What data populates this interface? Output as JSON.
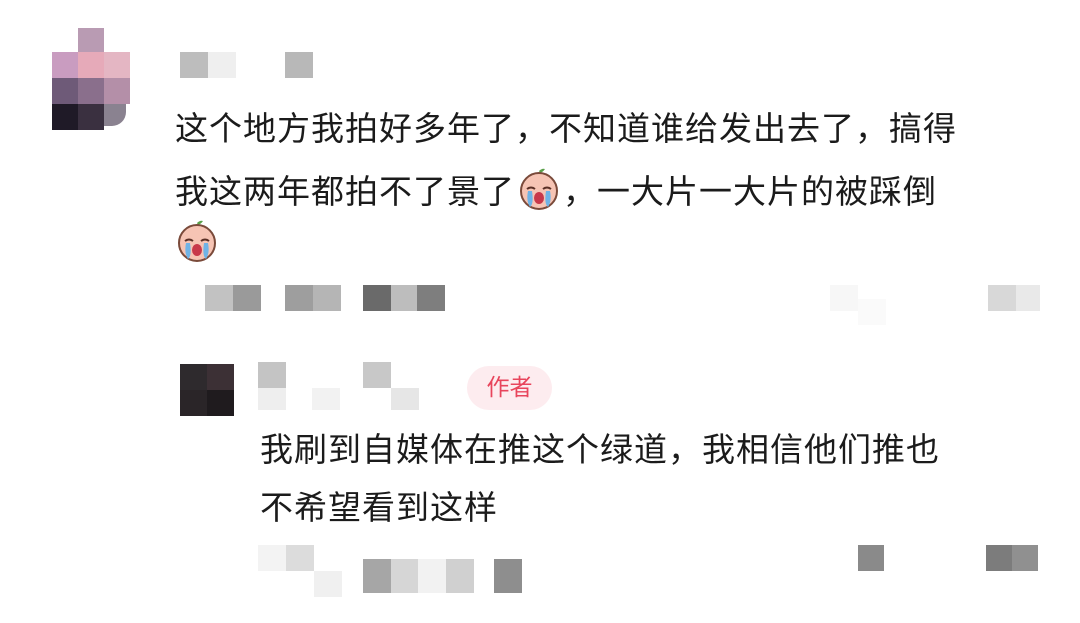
{
  "comment": {
    "line1": "这个地方我拍好多年了，不知道谁给发出去了，搞得",
    "line2a": "我这两年都拍不了景了",
    "line2b": "，一大片一大片的被踩倒",
    "emoji": "crying-face-icon"
  },
  "reply": {
    "author_tag": "作者",
    "line1": "我刷到自媒体在推这个绿道，我相信他们推也",
    "line2": "不希望看到这样"
  },
  "colors": {
    "tag_bg": "#fdecef",
    "tag_text": "#e8455c",
    "text": "#1b1b1b"
  }
}
